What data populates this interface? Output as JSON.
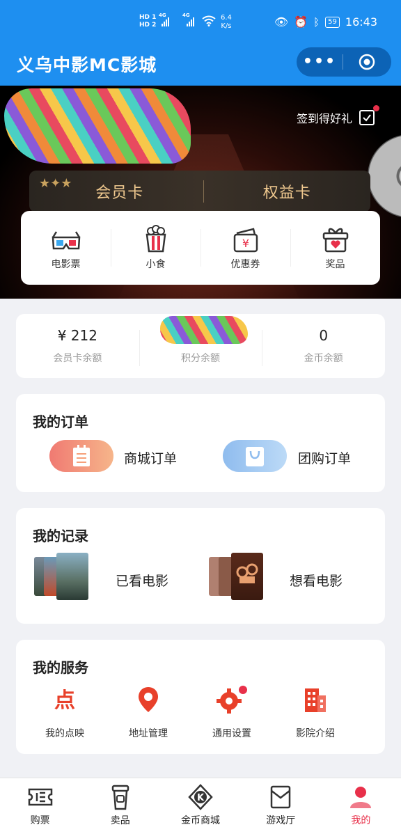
{
  "status_bar": {
    "network": "4G",
    "sim1": "HD 1",
    "sim2": "HD 2",
    "speed_value": "6.4",
    "speed_unit": "K/s",
    "battery": "59",
    "time": "16:43"
  },
  "header": {
    "title": "义乌中影MC影城",
    "more_icon": "more-dots-icon",
    "close_icon": "target-icon",
    "background_color": "#1e8ff0"
  },
  "banner": {
    "checkin_label": "签到得好礼",
    "member_card_label": "会员卡",
    "benefit_card_label": "权益卡",
    "quick_items": [
      {
        "label": "电影票",
        "icon": "3d-glasses-icon"
      },
      {
        "label": "小食",
        "icon": "popcorn-icon"
      },
      {
        "label": "优惠券",
        "icon": "coupon-icon"
      },
      {
        "label": "奖品",
        "icon": "gift-icon"
      }
    ]
  },
  "balances": [
    {
      "value": "¥ 212",
      "label": "会员卡余额"
    },
    {
      "value": "",
      "label": "积分余额"
    },
    {
      "value": "0",
      "label": "金币余额"
    }
  ],
  "orders": {
    "title": "我的订单",
    "items": [
      {
        "label": "商城订单",
        "icon": "notepad-icon",
        "color": "#f08a6a"
      },
      {
        "label": "团购订单",
        "icon": "shopping-bag-icon",
        "color": "#7fb3ee"
      }
    ]
  },
  "records": {
    "title": "我的记录",
    "items": [
      {
        "label": "已看电影",
        "icon": "movie-posters-icon"
      },
      {
        "label": "想看电影",
        "icon": "projector-posters-icon"
      }
    ]
  },
  "services": {
    "title": "我的服务",
    "items": [
      {
        "label": "我的点映",
        "icon": "dian-icon"
      },
      {
        "label": "地址管理",
        "icon": "location-pin-icon"
      },
      {
        "label": "通用设置",
        "icon": "gear-icon"
      },
      {
        "label": "影院介绍",
        "icon": "building-icon"
      }
    ]
  },
  "tabbar": {
    "accent_color": "#e8304a",
    "items": [
      {
        "label": "购票",
        "icon": "ticket-icon"
      },
      {
        "label": "卖品",
        "icon": "drink-cup-icon"
      },
      {
        "label": "金币商城",
        "icon": "k-coin-icon"
      },
      {
        "label": "游戏厅",
        "icon": "game-card-icon"
      },
      {
        "label": "我的",
        "icon": "user-icon",
        "active": true
      }
    ]
  }
}
